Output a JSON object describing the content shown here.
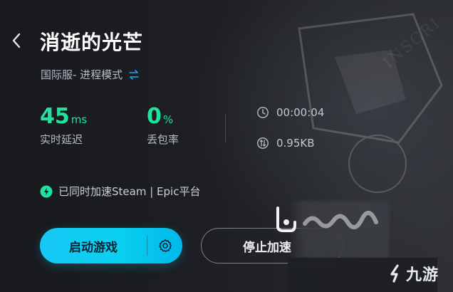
{
  "header": {
    "back_icon": "chevron-left-icon",
    "title": "消逝的光芒",
    "mode_text": "国际服- 进程模式",
    "swap_icon": "swap-arrows-icon"
  },
  "stats": {
    "latency": {
      "value": "45",
      "unit": "ms",
      "label": "实时延迟"
    },
    "packet_loss": {
      "value": "0",
      "unit": "%",
      "label": "丢包率"
    }
  },
  "info": {
    "duration": {
      "icon": "clock-icon",
      "value": "00:00:04"
    },
    "traffic": {
      "icon": "traffic-icon",
      "value": "0.95KB"
    }
  },
  "sync_notice": {
    "icon": "bolt-icon",
    "text": "已同时加速Steam | Epic平台"
  },
  "actions": {
    "launch_label": "启动游戏",
    "launch_settings_icon": "gear-icon",
    "stop_label": "停止加速"
  },
  "watermark": {
    "brand": "九游"
  },
  "colors": {
    "accent_green": "#1ee39c",
    "launch_button": "#0ad0f0",
    "background": "#1b1d22"
  }
}
